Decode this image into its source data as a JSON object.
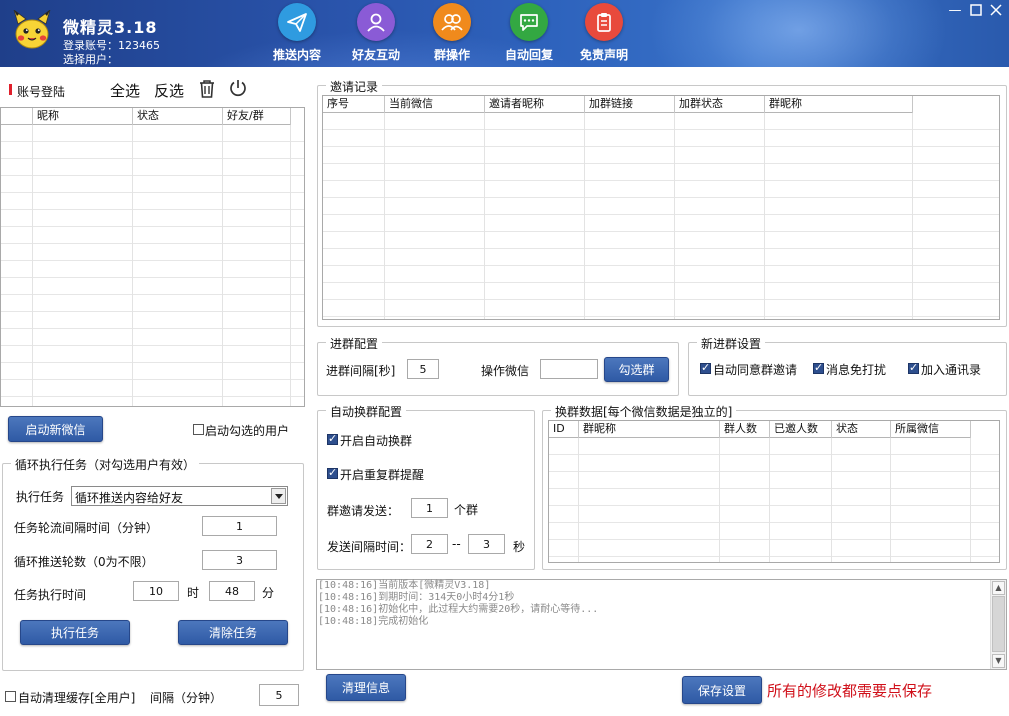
{
  "app": {
    "title": "微精灵3.18",
    "account_label": "登录账号：123465",
    "user_label": "选择用户："
  },
  "nav": [
    {
      "label": "推送内容",
      "icon": "paper-plane-icon",
      "color": "#2f9be0"
    },
    {
      "label": "好友互动",
      "icon": "user-icon",
      "color": "#8a5bd6"
    },
    {
      "label": "群操作",
      "icon": "group-icon",
      "color": "#f08a1c"
    },
    {
      "label": "自动回复",
      "icon": "chat-icon",
      "color": "#33a842"
    },
    {
      "label": "免责声明",
      "icon": "clipboard-icon",
      "color": "#e84a3c"
    }
  ],
  "left": {
    "account_login": "账号登陆",
    "select_all": "全选",
    "invert": "反选",
    "accounts_table": {
      "columns": [
        "昵称",
        "状态",
        "好友/群"
      ]
    },
    "start_wechat": "启动新微信",
    "start_selected": "启动勾选的用户",
    "loop_task": {
      "title": "循环执行任务（对勾选用户有效）",
      "exec_label": "执行任务",
      "exec_value": "循环推送内容给好友",
      "interval_label": "任务轮流间隔时间（分钟）",
      "interval_value": "1",
      "rounds_label": "循环推送轮数（0为不限）",
      "rounds_value": "3",
      "time_label": "任务执行时间",
      "hour_value": "10",
      "hour_unit": "时",
      "minute_value": "48",
      "minute_unit": "分",
      "run_button": "执行任务",
      "clear_button": "清除任务"
    },
    "auto_clean": "自动清理缓存[全用户]",
    "interval_min_label": "间隔（分钟）",
    "interval_min_value": "5"
  },
  "invite": {
    "title": "邀请记录",
    "columns": [
      "序号",
      "当前微信",
      "邀请者昵称",
      "加群链接",
      "加群状态",
      "群昵称"
    ]
  },
  "join": {
    "title": "进群配置",
    "interval_label": "进群间隔[秒]",
    "interval_value": "5",
    "op_wechat_label": "操作微信",
    "op_wechat_value": "",
    "pick_group": "勾选群"
  },
  "new_group": {
    "title": "新进群设置",
    "auto_accept": "自动同意群邀请",
    "mute": "消息免打扰",
    "add_contacts": "加入通讯录"
  },
  "auto_switch": {
    "title": "自动换群配置",
    "enable_switch": "开启自动换群",
    "enable_remind": "开启重复群提醒",
    "send_label": "群邀请发送：",
    "send_value": "1",
    "send_unit": "个群",
    "gap_label": "发送间隔时间：",
    "gap_from": "2",
    "gap_sep": "--",
    "gap_to": "3",
    "gap_unit": "秒"
  },
  "switch_data": {
    "title": "换群数据[每个微信数据是独立的]",
    "columns": [
      "ID",
      "群昵称",
      "群人数",
      "已邀人数",
      "状态",
      "所属微信"
    ]
  },
  "log": [
    "[10:48:16]当前版本[微精灵V3.18]",
    "[10:48:16]到期时间：314天0小时4分1秒",
    "[10:48:16]初始化中，此过程大约需要20秒，请耐心等待...",
    "[10:48:18]完成初始化"
  ],
  "bottom": {
    "clear_info": "清理信息",
    "save_settings": "保存设置",
    "save_notice": "所有的修改都需要点保存"
  }
}
